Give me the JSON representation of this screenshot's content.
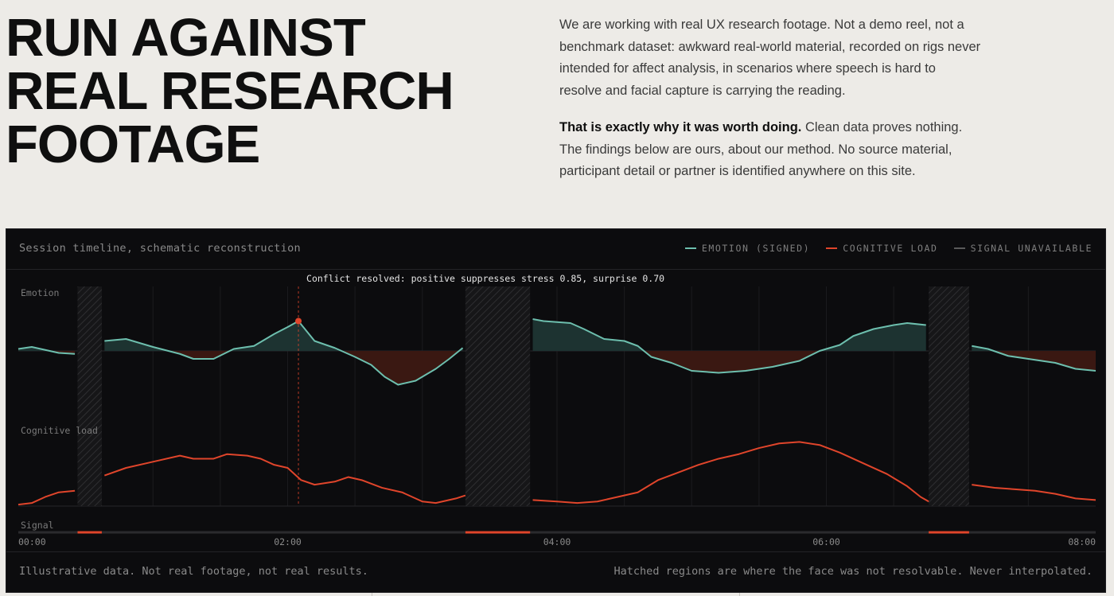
{
  "headline": {
    "line1": "RUN AGAINST",
    "line2": "REAL RESEARCH",
    "line3": "FOOTAGE"
  },
  "intro": {
    "p1": "We are working with real UX research footage. Not a demo reel, not a benchmark dataset: awkward real-world material, recorded on rigs never intended for affect analysis, in scenarios where speech is hard to resolve and facial capture is carrying the reading.",
    "p2_strong": "That is exactly why it was worth doing.",
    "p2_rest": " Clean data proves nothing. The findings below are ours, about our method. No source material, participant detail or partner is identified anywhere on this site."
  },
  "panel": {
    "title": "Session timeline, schematic reconstruction",
    "legend": [
      {
        "label": "EMOTION (SIGNED)",
        "color": "#6dbfae"
      },
      {
        "label": "COGNITIVE LOAD",
        "color": "#e0452b"
      },
      {
        "label": "SIGNAL UNAVAILABLE",
        "color": "#5a5a5a"
      }
    ],
    "footer_left": "Illustrative data. Not real footage, not real results.",
    "footer_right": "Hatched regions are where the face was not resolvable. Never interpolated."
  },
  "colors": {
    "emotion": "#6dbfae",
    "emotion_fill_pos": "#1d3331",
    "emotion_fill_neg": "#3a1812",
    "load": "#e0452b",
    "annotation": "#e0452b",
    "hatch": "#2a2a2c",
    "grid": "#1b1b1e"
  },
  "chart_data": {
    "type": "line",
    "title": "Session timeline, schematic reconstruction",
    "x_unit": "minutes",
    "xlim": [
      0,
      8
    ],
    "x_ticks": [
      "00:00",
      "02:00",
      "04:00",
      "06:00",
      "08:00"
    ],
    "row_labels": {
      "emotion": "Emotion",
      "load": "Cognitive load",
      "signal": "Signal"
    },
    "emotion_ylim": [
      -1,
      1
    ],
    "load_ylim": [
      0,
      1
    ],
    "unavailable_regions": [
      [
        0.44,
        0.62
      ],
      [
        3.32,
        3.8
      ],
      [
        6.76,
        7.06
      ]
    ],
    "annotation": {
      "x": 2.08,
      "text": "Conflict resolved: positive suppresses stress 0.85, surprise 0.70"
    },
    "series": [
      {
        "name": "EMOTION (SIGNED)",
        "points": [
          [
            0.0,
            0.02
          ],
          [
            0.1,
            0.04
          ],
          [
            0.2,
            0.01
          ],
          [
            0.3,
            -0.02
          ],
          [
            0.42,
            -0.03
          ],
          [
            0.64,
            0.1
          ],
          [
            0.8,
            0.12
          ],
          [
            1.0,
            0.04
          ],
          [
            1.2,
            -0.03
          ],
          [
            1.3,
            -0.08
          ],
          [
            1.45,
            -0.08
          ],
          [
            1.6,
            0.02
          ],
          [
            1.75,
            0.05
          ],
          [
            1.9,
            0.17
          ],
          [
            2.0,
            0.24
          ],
          [
            2.08,
            0.3
          ],
          [
            2.2,
            0.1
          ],
          [
            2.35,
            0.03
          ],
          [
            2.5,
            -0.06
          ],
          [
            2.62,
            -0.14
          ],
          [
            2.72,
            -0.26
          ],
          [
            2.82,
            -0.34
          ],
          [
            2.95,
            -0.3
          ],
          [
            3.1,
            -0.18
          ],
          [
            3.2,
            -0.08
          ],
          [
            3.3,
            0.03
          ],
          [
            3.82,
            0.32
          ],
          [
            3.9,
            0.3
          ],
          [
            4.1,
            0.28
          ],
          [
            4.2,
            0.22
          ],
          [
            4.35,
            0.12
          ],
          [
            4.5,
            0.1
          ],
          [
            4.6,
            0.05
          ],
          [
            4.7,
            -0.06
          ],
          [
            4.85,
            -0.12
          ],
          [
            5.0,
            -0.2
          ],
          [
            5.2,
            -0.22
          ],
          [
            5.4,
            -0.2
          ],
          [
            5.6,
            -0.16
          ],
          [
            5.8,
            -0.1
          ],
          [
            5.95,
            0.0
          ],
          [
            6.1,
            0.06
          ],
          [
            6.2,
            0.15
          ],
          [
            6.35,
            0.22
          ],
          [
            6.5,
            0.26
          ],
          [
            6.6,
            0.28
          ],
          [
            6.74,
            0.26
          ],
          [
            7.08,
            0.05
          ],
          [
            7.2,
            0.02
          ],
          [
            7.35,
            -0.05
          ],
          [
            7.5,
            -0.08
          ],
          [
            7.7,
            -0.12
          ],
          [
            7.85,
            -0.18
          ],
          [
            8.0,
            -0.2
          ]
        ]
      },
      {
        "name": "COGNITIVE LOAD",
        "points": [
          [
            0.0,
            0.01
          ],
          [
            0.1,
            0.02
          ],
          [
            0.2,
            0.06
          ],
          [
            0.3,
            0.09
          ],
          [
            0.42,
            0.1
          ],
          [
            0.64,
            0.2
          ],
          [
            0.8,
            0.25
          ],
          [
            1.0,
            0.29
          ],
          [
            1.2,
            0.33
          ],
          [
            1.3,
            0.31
          ],
          [
            1.45,
            0.31
          ],
          [
            1.55,
            0.34
          ],
          [
            1.7,
            0.33
          ],
          [
            1.8,
            0.31
          ],
          [
            1.9,
            0.27
          ],
          [
            2.0,
            0.25
          ],
          [
            2.1,
            0.17
          ],
          [
            2.2,
            0.14
          ],
          [
            2.35,
            0.16
          ],
          [
            2.45,
            0.19
          ],
          [
            2.55,
            0.17
          ],
          [
            2.7,
            0.12
          ],
          [
            2.85,
            0.09
          ],
          [
            3.0,
            0.03
          ],
          [
            3.1,
            0.02
          ],
          [
            3.25,
            0.05
          ],
          [
            3.32,
            0.07
          ],
          [
            3.82,
            0.04
          ],
          [
            4.0,
            0.03
          ],
          [
            4.15,
            0.02
          ],
          [
            4.3,
            0.03
          ],
          [
            4.45,
            0.06
          ],
          [
            4.6,
            0.09
          ],
          [
            4.75,
            0.17
          ],
          [
            4.9,
            0.22
          ],
          [
            5.05,
            0.27
          ],
          [
            5.2,
            0.31
          ],
          [
            5.35,
            0.34
          ],
          [
            5.5,
            0.38
          ],
          [
            5.65,
            0.41
          ],
          [
            5.8,
            0.42
          ],
          [
            5.95,
            0.4
          ],
          [
            6.1,
            0.35
          ],
          [
            6.3,
            0.27
          ],
          [
            6.45,
            0.21
          ],
          [
            6.6,
            0.13
          ],
          [
            6.7,
            0.06
          ],
          [
            6.76,
            0.03
          ],
          [
            7.08,
            0.14
          ],
          [
            7.25,
            0.12
          ],
          [
            7.4,
            0.11
          ],
          [
            7.55,
            0.1
          ],
          [
            7.7,
            0.08
          ],
          [
            7.85,
            0.05
          ],
          [
            8.0,
            0.04
          ]
        ]
      }
    ]
  }
}
